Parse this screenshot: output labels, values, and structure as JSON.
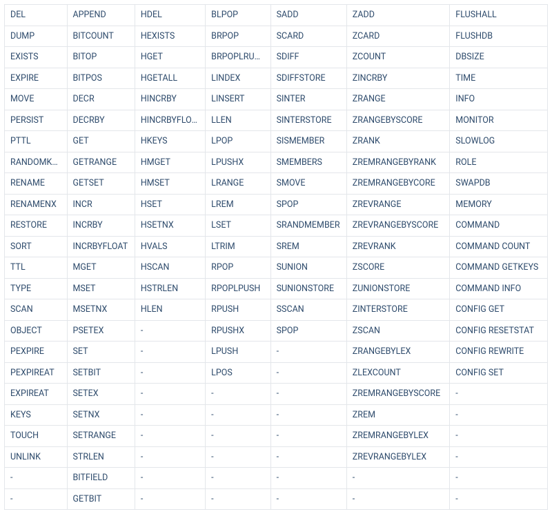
{
  "table": {
    "columns": [
      [
        "DEL",
        "DUMP",
        "EXISTS",
        "EXPIRE",
        "MOVE",
        "PERSIST",
        "PTTL",
        "RANDOMKEY",
        "RENAME",
        "RENAMENX",
        "RESTORE",
        "SORT",
        "TTL",
        "TYPE",
        "SCAN",
        "OBJECT",
        "PEXPIRE",
        "PEXPIREAT",
        "EXPIREAT",
        "KEYS",
        "TOUCH",
        "UNLINK",
        "-",
        "-"
      ],
      [
        "APPEND",
        "BITCOUNT",
        "BITOP",
        "BITPOS",
        "DECR",
        "DECRBY",
        "GET",
        "GETRANGE",
        "GETSET",
        "INCR",
        "INCRBY",
        "INCRBYFLOAT",
        "MGET",
        "MSET",
        "MSETNX",
        "PSETEX",
        "SET",
        "SETBIT",
        "SETEX",
        "SETNX",
        "SETRANGE",
        "STRLEN",
        "BITFIELD",
        "GETBIT"
      ],
      [
        "HDEL",
        "HEXISTS",
        "HGET",
        "HGETALL",
        "HINCRBY",
        "HINCRBYFLOAT",
        "HKEYS",
        "HMGET",
        "HMSET",
        "HSET",
        "HSETNX",
        "HVALS",
        "HSCAN",
        "HSTRLEN",
        "HLEN",
        "-",
        "-",
        "-",
        "-",
        "-",
        "-",
        "-",
        "-",
        "-"
      ],
      [
        "BLPOP",
        "BRPOP",
        "BRPOPLRUSH",
        "LINDEX",
        "LINSERT",
        "LLEN",
        "LPOP",
        "LPUSHX",
        "LRANGE",
        "LREM",
        "LSET",
        "LTRIM",
        "RPOP",
        "RPOPLPUSH",
        "RPUSH",
        "RPUSHX",
        "LPUSH",
        "LPOS",
        "-",
        "-",
        "-",
        "-",
        "-",
        "-"
      ],
      [
        "SADD",
        "SCARD",
        "SDIFF",
        "SDIFFSTORE",
        "SINTER",
        "SINTERSTORE",
        "SISMEMBER",
        "SMEMBERS",
        "SMOVE",
        "SPOP",
        "SRANDMEMBER",
        "SREM",
        "SUNION",
        "SUNIONSTORE",
        "SSCAN",
        "SPOP",
        "-",
        "-",
        "-",
        "-",
        "-",
        "-",
        "-",
        "-"
      ],
      [
        "ZADD",
        "ZCARD",
        "ZCOUNT",
        "ZINCRBY",
        "ZRANGE",
        "ZRANGEBYSCORE",
        "ZRANK",
        "ZREMRANGEBYRANK",
        "ZREMRANGEBYCORE",
        "ZREVRANGE",
        "ZREVRANGEBYSCORE",
        "ZREVRANK",
        "ZSCORE",
        "ZUNIONSTORE",
        "ZINTERSTORE",
        "ZSCAN",
        "ZRANGEBYLEX",
        "ZLEXCOUNT",
        "ZREMRANGEBYSCORE",
        "ZREM",
        "ZREMRANGEBYLEX",
        "ZREVRANGEBYLEX",
        "-",
        "-"
      ],
      [
        "FLUSHALL",
        "FLUSHDB",
        "DBSIZE",
        "TIME",
        "INFO",
        "MONITOR",
        "SLOWLOG",
        "ROLE",
        "SWAPDB",
        "MEMORY",
        "COMMAND",
        "COMMAND COUNT",
        "COMMAND GETKEYS",
        "COMMAND INFO",
        "CONFIG GET",
        "CONFIG RESETSTAT",
        "CONFIG REWRITE",
        "CONFIG SET",
        "-",
        "-",
        "-",
        "-",
        "-",
        "-"
      ]
    ]
  }
}
